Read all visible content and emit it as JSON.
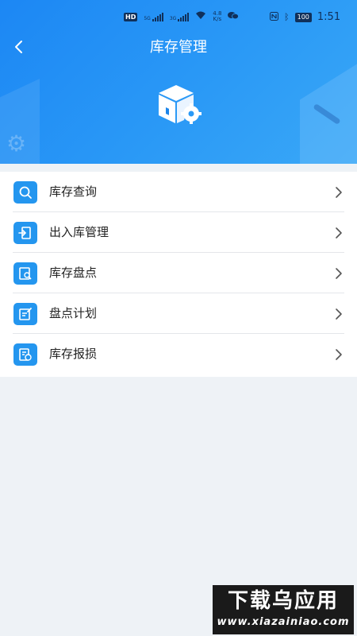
{
  "status_bar": {
    "hd": "HD",
    "net1": "5G",
    "net2": "3G",
    "speed_value": "4.8",
    "speed_unit": "K/s",
    "battery": "100",
    "time": "1:51"
  },
  "header": {
    "title": "库存管理",
    "back_icon": "chevron-left-icon",
    "hero_icon": "box-gear-icon",
    "gradient_start": "#1c87f4",
    "gradient_end": "#3aa8f7"
  },
  "menu": {
    "items": [
      {
        "label": "库存查询",
        "icon": "search-icon"
      },
      {
        "label": "出入库管理",
        "icon": "inbound-outbound-icon"
      },
      {
        "label": "库存盘点",
        "icon": "stocktake-icon"
      },
      {
        "label": "盘点计划",
        "icon": "plan-edit-icon"
      },
      {
        "label": "库存报损",
        "icon": "damage-report-icon"
      }
    ],
    "icon_color": "#2496ef"
  },
  "watermark": {
    "title": "下载乌应用",
    "url": "www.xiazainiao.com"
  }
}
